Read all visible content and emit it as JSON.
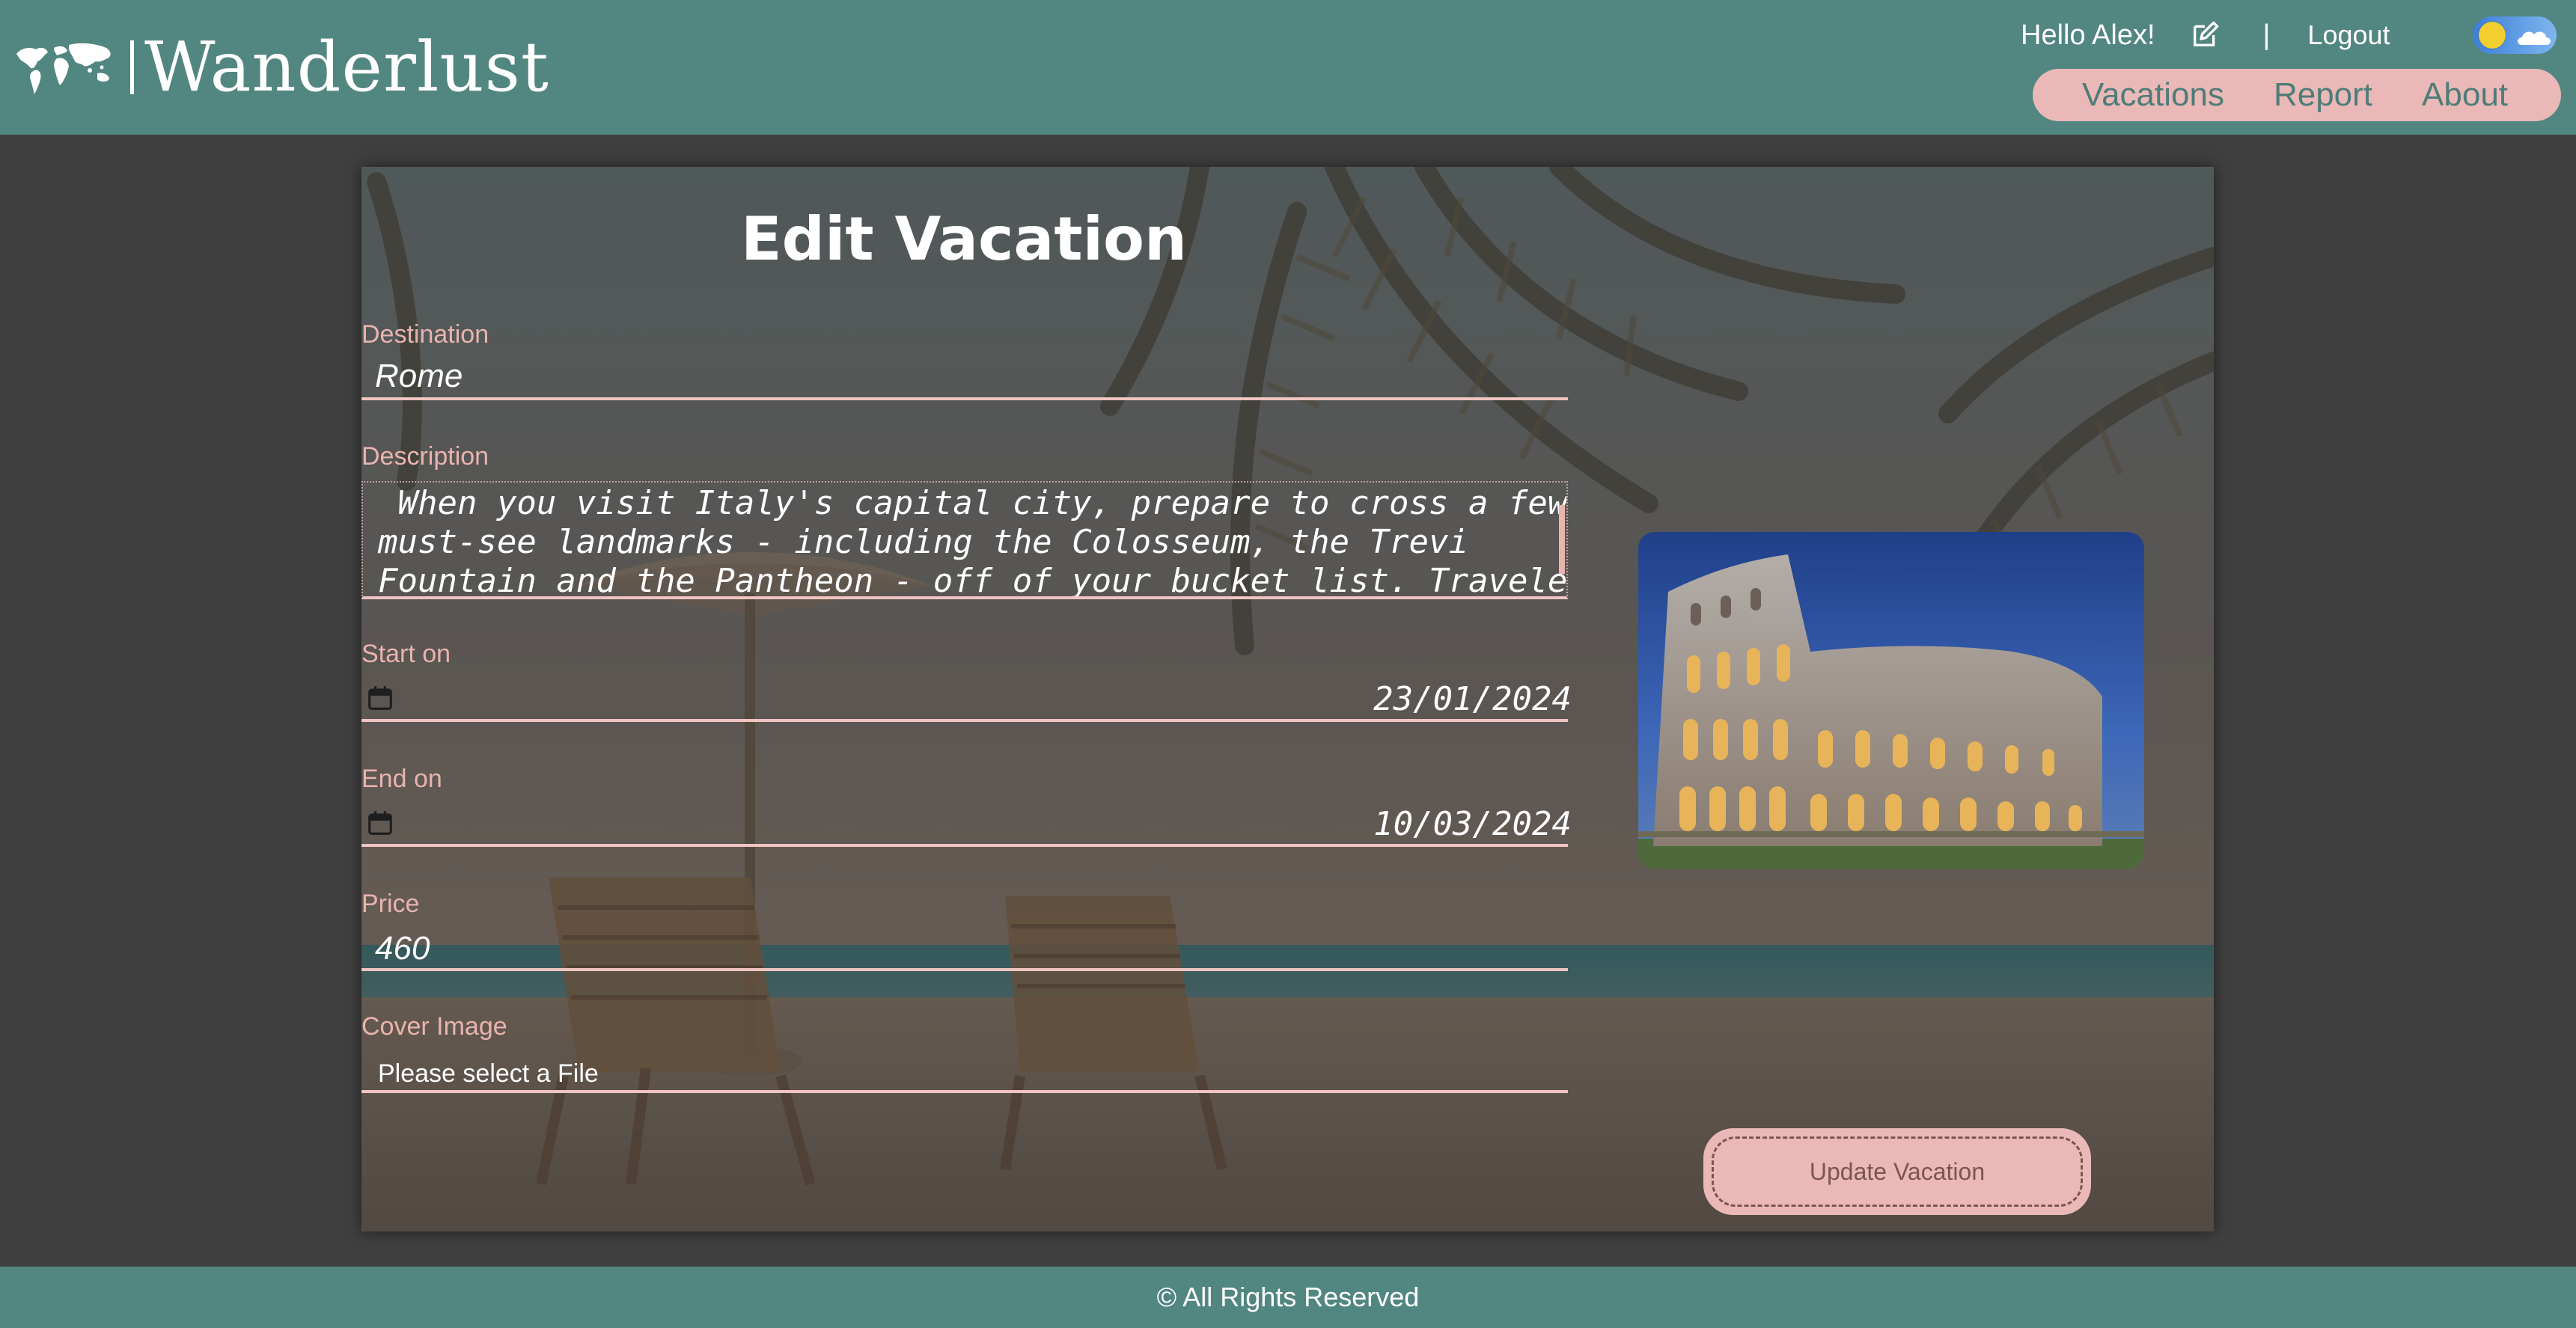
{
  "app": {
    "brand": "Wanderlust"
  },
  "header": {
    "greeting": "Hello Alex!",
    "separator": "|",
    "logout_label": "Logout",
    "theme": "light",
    "nav": [
      {
        "label": "Vacations"
      },
      {
        "label": "Report"
      },
      {
        "label": "About"
      }
    ]
  },
  "form": {
    "title": "Edit Vacation",
    "destination": {
      "label": "Destination",
      "value": "Rome"
    },
    "description": {
      "label": "Description",
      "value": " When you visit Italy's capital city, prepare to cross a few\nmust-see landmarks - including the Colosseum, the Trevi\nFountain and the Pantheon - off of your bucket list. Travelers"
    },
    "start_on": {
      "label": "Start on",
      "value": "23/01/2024"
    },
    "end_on": {
      "label": "End on",
      "value": "10/03/2024"
    },
    "price": {
      "label": "Price",
      "value": "460"
    },
    "cover_image": {
      "label": "Cover Image",
      "placeholder": "Please select a File"
    },
    "submit_label": "Update Vacation"
  },
  "footer": {
    "text": "© All Rights Reserved"
  },
  "colors": {
    "header_bg": "#528681",
    "accent_pink": "#eab9b7",
    "label_pink": "#e9b3ae",
    "page_bg": "#3f3f3f"
  },
  "icons": {
    "logo": "world-map-icon",
    "edit_profile": "edit-icon",
    "date_picker": "calendar-icon",
    "theme_toggle": "sun-cloud-toggle"
  }
}
